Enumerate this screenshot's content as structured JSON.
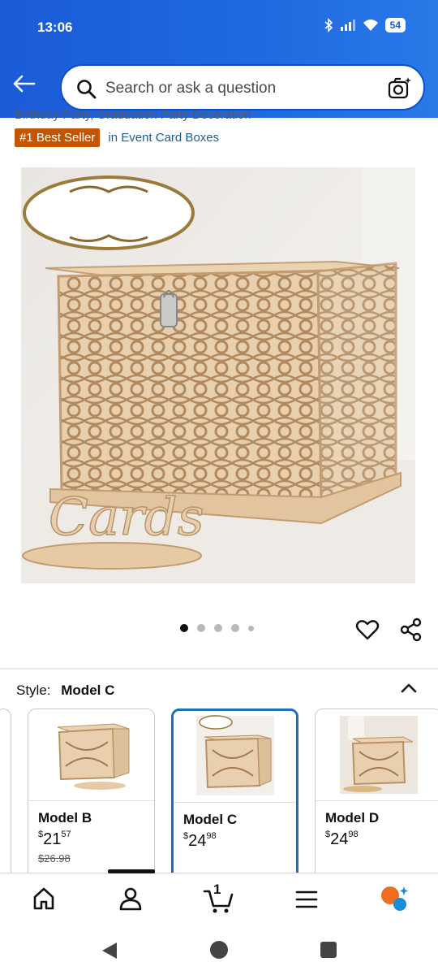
{
  "status_bar": {
    "time": "13:06",
    "battery": "54"
  },
  "header": {
    "search_placeholder": "Search or ask a question"
  },
  "product": {
    "subtitle": "Birthday Party, Graduation Party Decoration",
    "badge": "#1 Best Seller",
    "category_link": "in Event Card Boxes",
    "image_text": "Cards",
    "gallery": {
      "total_images": 5,
      "active_index": 0
    }
  },
  "style_selector": {
    "label": "Style:",
    "selected": "Model C",
    "options": [
      {
        "name": "Model B",
        "price_symbol": "$",
        "price_whole": "21",
        "price_fraction": "57",
        "was_price": "$26.98"
      },
      {
        "name": "Model C",
        "price_symbol": "$",
        "price_whole": "24",
        "price_fraction": "98",
        "was_price": ""
      },
      {
        "name": "Model D",
        "price_symbol": "$",
        "price_whole": "24",
        "price_fraction": "98",
        "was_price": ""
      }
    ]
  },
  "bottom_nav": {
    "cart_count": "1",
    "items": [
      "home-icon",
      "account-icon",
      "cart-icon",
      "menu-icon",
      "rufus-icon"
    ]
  },
  "colors": {
    "header_blue": "#1b5bd8",
    "badge_orange": "#c45500",
    "link_blue": "#1c5d8f",
    "selected_border": "#1f6dbd"
  }
}
